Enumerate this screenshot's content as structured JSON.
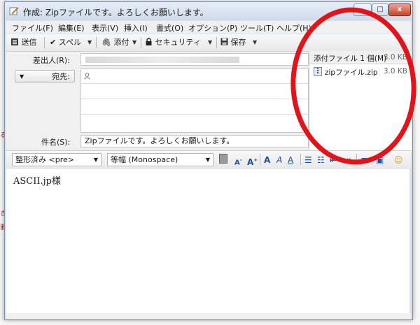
{
  "window": {
    "title": "作成: Zipファイルです。よろしくお願いします。",
    "min_label": "–",
    "max_label": "□",
    "close_label": "x"
  },
  "menu": {
    "items": [
      "ファイル(F)",
      "編集(E)",
      "表示(V)",
      "挿入(I)",
      "書式(O)",
      "オプション(P)",
      "ツール(T)",
      "ヘルプ(H)"
    ]
  },
  "toolbar": {
    "send_label": "送信",
    "spell_label": "スペル",
    "attach_label": "添付",
    "security_label": "セキュリティ",
    "save_label": "保存"
  },
  "header": {
    "from_label": "差出人(R):",
    "to_label": "宛先:",
    "subject_label": "件名(S):",
    "subject_value": "Zipファイルです。よろしくお願いします。"
  },
  "attachments": {
    "header_label": "添付ファイル 1 個(M)",
    "header_size": "3.0 KB",
    "files": [
      {
        "name": "zipファイル.zip",
        "size": "3.0 KB"
      }
    ]
  },
  "format": {
    "paragraph_style": "整形済み <pre>",
    "font": "等幅 (Monospace)"
  },
  "body": {
    "text": "ASCII.jp様"
  },
  "colors": {
    "annotation": "#e0141b",
    "titlebar": "#d6e2f0"
  }
}
